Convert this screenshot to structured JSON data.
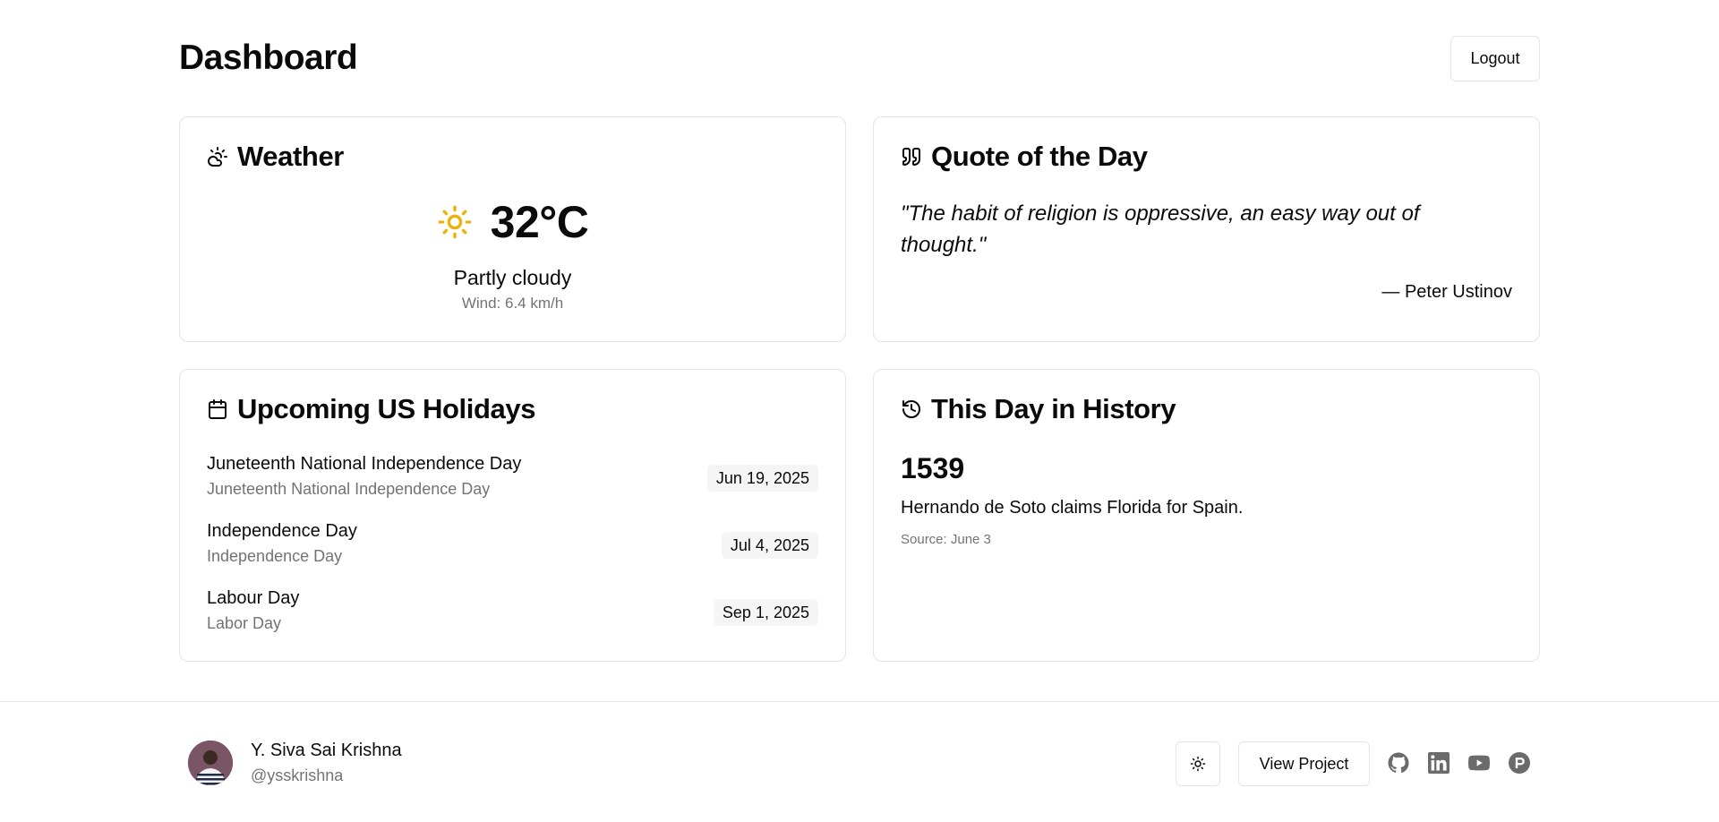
{
  "header": {
    "title": "Dashboard",
    "logout_label": "Logout"
  },
  "weather": {
    "title": "Weather",
    "temperature": "32°C",
    "condition": "Partly cloudy",
    "wind": "Wind: 6.4 km/h",
    "icon": "sun-icon",
    "accent_color": "#eab308"
  },
  "quote": {
    "title": "Quote of the Day",
    "text": "\"The habit of religion is oppressive, an easy way out of thought.\"",
    "author": "— Peter Ustinov"
  },
  "holidays": {
    "title": "Upcoming US Holidays",
    "items": [
      {
        "name": "Juneteenth National Independence Day",
        "local_name": "Juneteenth National Independence Day",
        "date": "Jun 19, 2025"
      },
      {
        "name": "Independence Day",
        "local_name": "Independence Day",
        "date": "Jul 4, 2025"
      },
      {
        "name": "Labour Day",
        "local_name": "Labor Day",
        "date": "Sep 1, 2025"
      }
    ]
  },
  "history": {
    "title": "This Day in History",
    "year": "1539",
    "event": "Hernando de Soto claims Florida for Spain.",
    "source": "Source: June 3"
  },
  "footer": {
    "user_name": "Y. Siva Sai Krishna",
    "user_handle": "@ysskrishna",
    "view_project_label": "View Project",
    "social_icons": [
      "github-icon",
      "linkedin-icon",
      "youtube-icon",
      "producthunt-icon"
    ]
  }
}
